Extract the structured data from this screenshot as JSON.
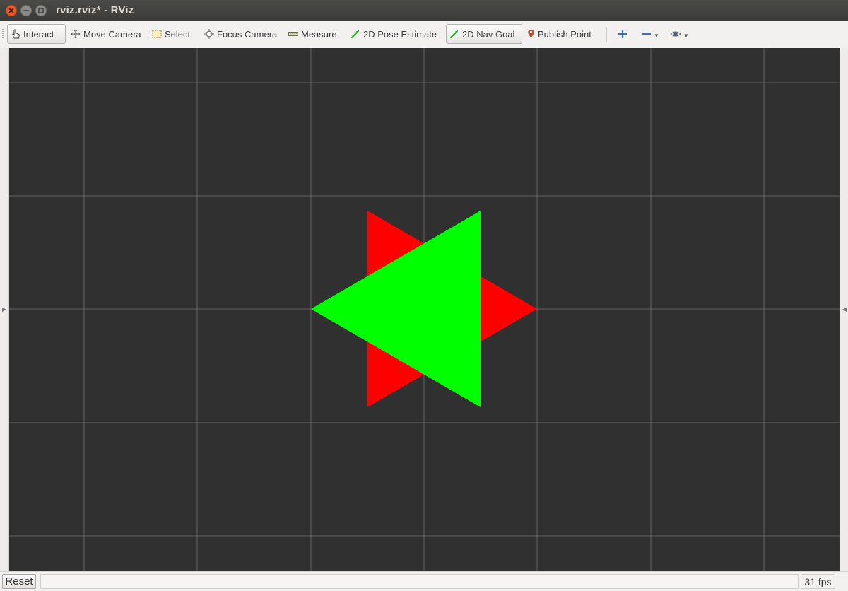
{
  "window": {
    "title": "rviz.rviz* - RViz"
  },
  "toolbar": {
    "tools": [
      {
        "label": "Interact",
        "icon": "hand-icon",
        "active": true
      },
      {
        "label": "Move Camera",
        "icon": "move-camera-icon",
        "active": false
      },
      {
        "label": "Select",
        "icon": "select-icon",
        "active": false
      },
      {
        "label": "Focus Camera",
        "icon": "focus-camera-icon",
        "active": false
      },
      {
        "label": "Measure",
        "icon": "ruler-icon",
        "active": false
      },
      {
        "label": "2D Pose Estimate",
        "icon": "green-arrow-icon",
        "active": false
      },
      {
        "label": "2D Nav Goal",
        "icon": "green-arrow-icon",
        "active": true
      },
      {
        "label": "Publish Point",
        "icon": "map-pin-icon",
        "active": false
      }
    ],
    "extra_icons": [
      "add-tool-icon",
      "remove-tool-icon",
      "eye-icon"
    ]
  },
  "view": {
    "background": "#303030",
    "grid_color": "#8a8a8a",
    "markers": [
      {
        "shape": "triangle",
        "color": "#ff0000",
        "pointing": "right"
      },
      {
        "shape": "triangle",
        "color": "#00ff00",
        "pointing": "left"
      }
    ]
  },
  "statusbar": {
    "reset_label": "Reset",
    "fps": "31 fps"
  }
}
